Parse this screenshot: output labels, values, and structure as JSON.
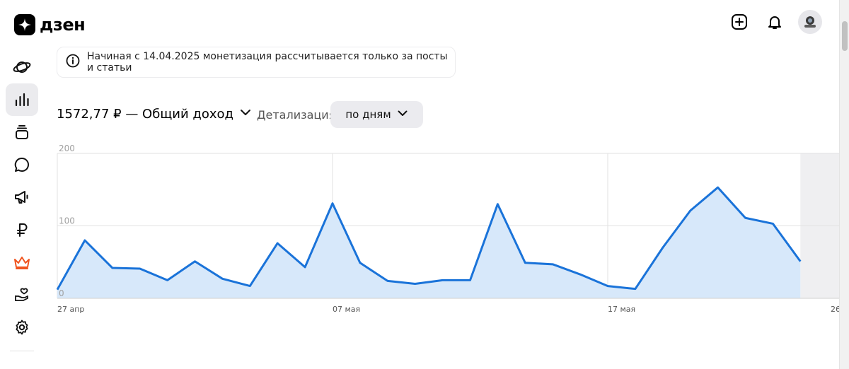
{
  "header": {
    "logo_text": "дзен",
    "icons": [
      "plus-icon",
      "bell-icon",
      "avatar"
    ]
  },
  "sidebar": {
    "items": [
      {
        "name": "planet-icon",
        "active": false
      },
      {
        "name": "stats-icon",
        "active": true
      },
      {
        "name": "stack-icon",
        "active": false
      },
      {
        "name": "comments-icon",
        "active": false
      },
      {
        "name": "megaphone-icon",
        "active": false
      },
      {
        "name": "ruble-icon",
        "active": false
      },
      {
        "name": "crown-icon",
        "active": false
      },
      {
        "name": "heart-hand-icon",
        "active": false
      },
      {
        "name": "gear-icon",
        "active": false
      }
    ]
  },
  "notice": {
    "text": "Начиная с 14.04.2025 монетизация рассчитывается только за посты и статьи"
  },
  "income": {
    "label": "1572,77 ₽ — Общий доход"
  },
  "detail": {
    "label": "Детализация",
    "selected": "по дням"
  },
  "colors": {
    "line": "#1a73d9",
    "area": "#d7e8fa",
    "accent_crown": "#f0541e"
  },
  "chart_data": {
    "type": "area",
    "x": [
      "27 апр",
      "28 апр",
      "29 апр",
      "30 апр",
      "01 мая",
      "02 мая",
      "03 мая",
      "04 мая",
      "05 мая",
      "06 мая",
      "07 мая",
      "08 мая",
      "09 мая",
      "10 мая",
      "11 мая",
      "12 мая",
      "13 мая",
      "14 мая",
      "15 мая",
      "16 мая",
      "17 мая",
      "18 мая",
      "19 мая",
      "20 мая",
      "21 мая",
      "22 мая",
      "23 мая",
      "24 мая"
    ],
    "values": [
      12,
      80,
      42,
      41,
      25,
      51,
      27,
      17,
      76,
      43,
      131,
      49,
      24,
      20,
      25,
      25,
      130,
      49,
      47,
      33,
      17,
      13,
      70,
      121,
      153,
      111,
      103,
      51
    ],
    "x_tick_labels": [
      "27 апр",
      "07 мая",
      "17 мая",
      "26"
    ],
    "y_tick_labels": [
      "200",
      "100",
      "0"
    ],
    "ylim": [
      0,
      200
    ],
    "grid": true
  }
}
